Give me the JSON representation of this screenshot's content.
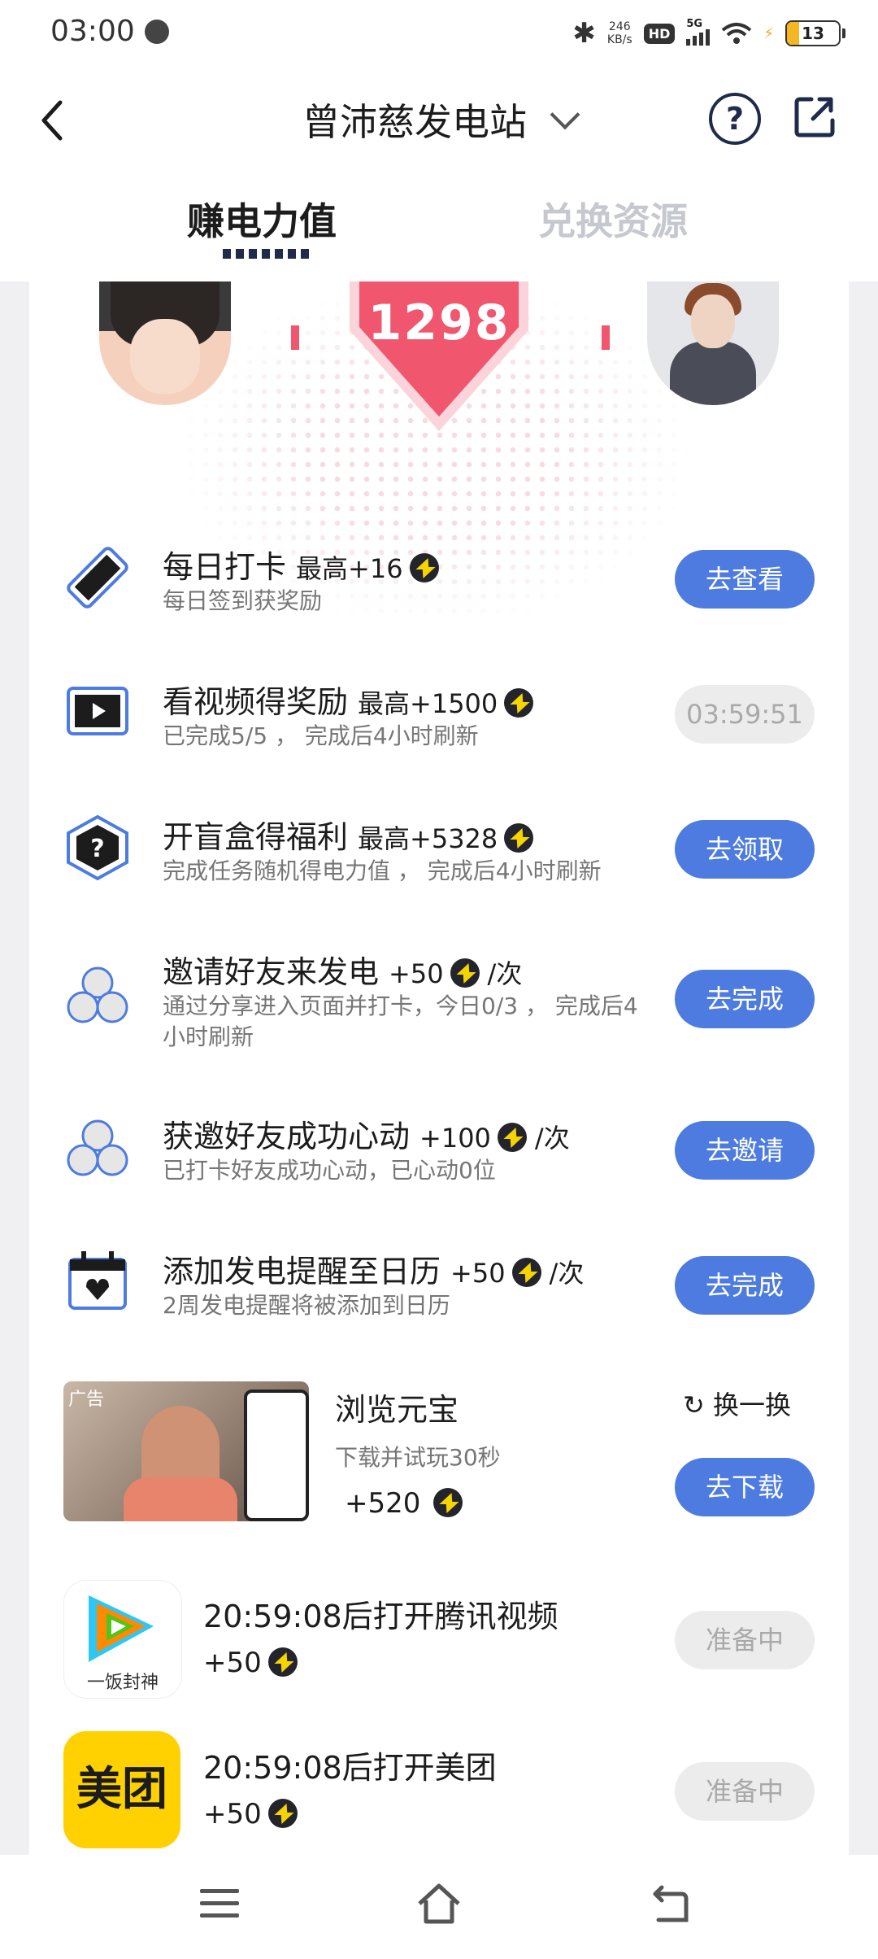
{
  "status_bar": {
    "time": "03:00",
    "net_speed_value": "246",
    "net_speed_unit": "KB/s",
    "hd": "HD",
    "signal": "5G",
    "battery": "13"
  },
  "header": {
    "title": "曾沛慈发电站"
  },
  "tabs": [
    {
      "label": "赚电力值",
      "active": true
    },
    {
      "label": "兑换资源",
      "active": false
    }
  ],
  "hero": {
    "power_value": "1298"
  },
  "tasks": [
    {
      "title": "每日打卡",
      "reward": "最高+16",
      "per": "",
      "subtitle": "每日签到获奖励",
      "button": "去查看",
      "button_state": "active"
    },
    {
      "title": "看视频得奖励",
      "reward": "最高+1500",
      "per": "",
      "subtitle": "已完成5/5 ， 完成后4小时刷新",
      "button": "03:59:51",
      "button_state": "disabled"
    },
    {
      "title": "开盲盒得福利",
      "reward": "最高+5328",
      "per": "",
      "subtitle": "完成任务随机得电力值 ， 完成后4小时刷新",
      "button": "去领取",
      "button_state": "active"
    },
    {
      "title": "邀请好友来发电",
      "reward": "+50",
      "per": "/次",
      "subtitle": "通过分享进入页面并打卡，今日0/3 ， 完成后4小时刷新",
      "button": "去完成",
      "button_state": "active"
    },
    {
      "title": "获邀好友成功心动",
      "reward": "+100",
      "per": "/次",
      "subtitle": "已打卡好友成功心动，已心动0位",
      "button": "去邀请",
      "button_state": "active"
    },
    {
      "title": "添加发电提醒至日历",
      "reward": "+50",
      "per": "/次",
      "subtitle": "2周发电提醒将被添加到日历",
      "button": "去完成",
      "button_state": "active"
    }
  ],
  "ad": {
    "tag": "广告",
    "title": "浏览元宝",
    "subtitle": "下载并试玩30秒",
    "reward": "+520",
    "refresh_label": "换一换",
    "button": "去下载"
  },
  "apps": [
    {
      "title": "20:59:08后打开腾讯视频",
      "reward": "+50",
      "button": "准备中",
      "icon_caption": "一饭封神"
    },
    {
      "title": "20:59:08后打开美团",
      "reward": "+50",
      "button": "准备中",
      "icon_text": "美团"
    }
  ],
  "colors": {
    "primary_button": "#4d7be0",
    "heart": "#f0566e",
    "disabled_button": "#ececec"
  }
}
